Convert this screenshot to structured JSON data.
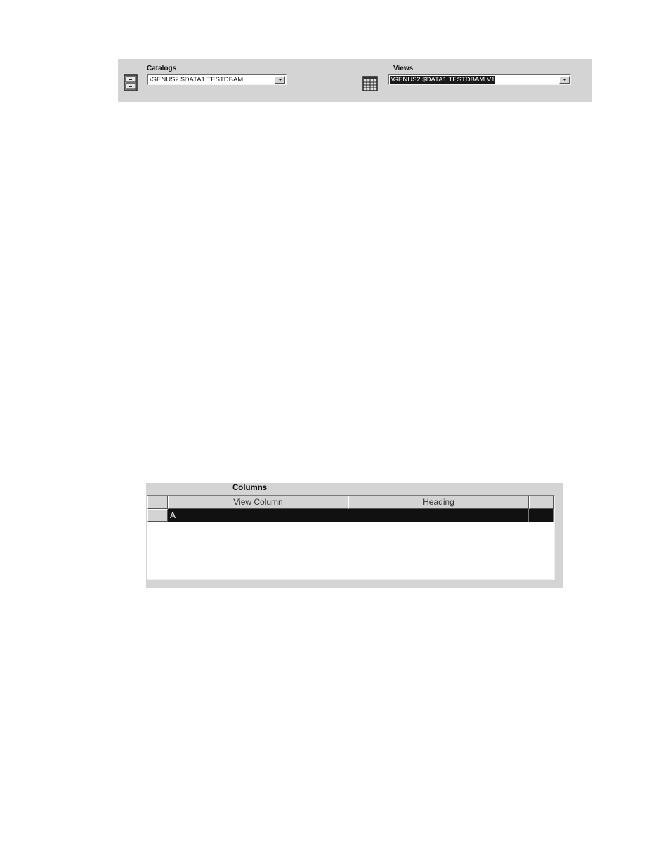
{
  "toolbar": {
    "catalogs": {
      "label": "Catalogs",
      "selected_value": "\\GENUS2.$DATA1.TESTDBAM",
      "icon": "file-cabinet-icon"
    },
    "views": {
      "label": "Views",
      "selected_value": "\\GENUS2.$DATA1.TESTDBAM.V1",
      "icon": "grid-table-icon"
    }
  },
  "columns": {
    "title": "Columns",
    "headers": [
      "View Column",
      "Heading"
    ],
    "rows": [
      {
        "view_column": "A",
        "heading": ""
      }
    ]
  },
  "colors": {
    "panel_gray": "#d4d4d4",
    "selection": "#111111"
  }
}
